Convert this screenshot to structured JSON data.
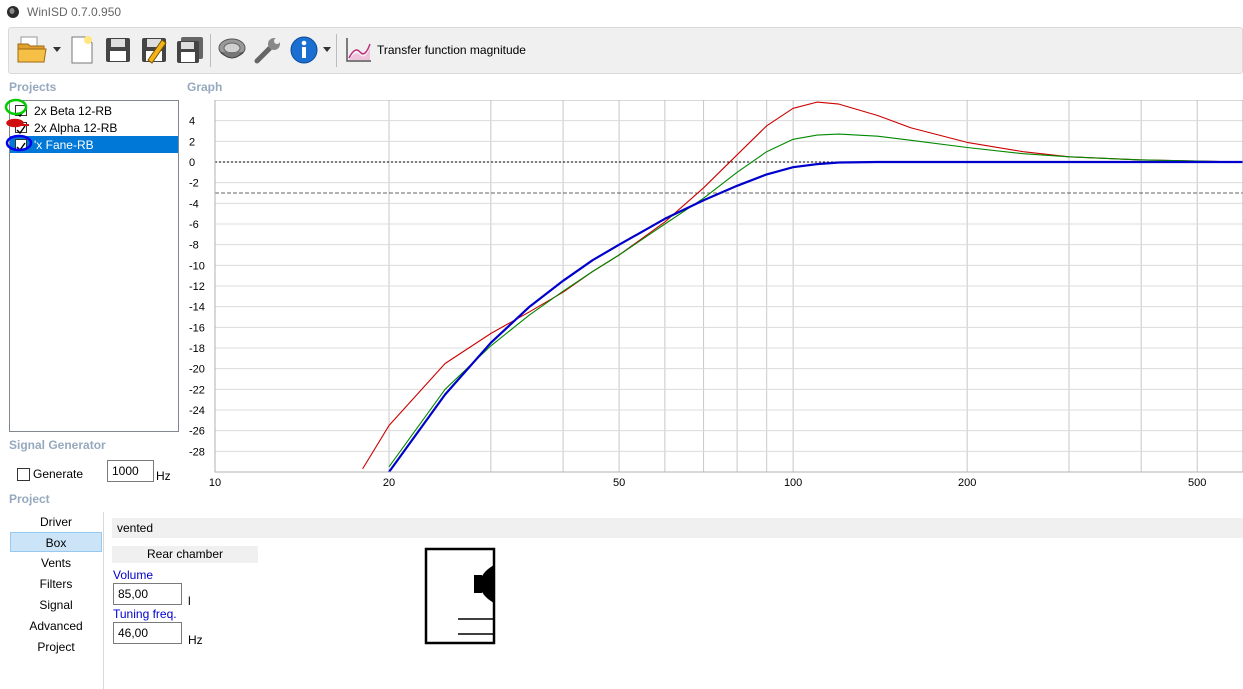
{
  "window": {
    "title": "WinISD 0.7.0.950"
  },
  "toolbar": {
    "buttons": [
      {
        "name": "open-project",
        "icon": "folder-open-icon",
        "dropdown": true
      },
      {
        "name": "new-project",
        "icon": "new-document-icon"
      },
      {
        "name": "save-project",
        "icon": "floppy-icon"
      },
      {
        "name": "save-as-project",
        "icon": "floppy-pencil-icon"
      },
      {
        "name": "save-all-projects",
        "icon": "floppy-multiple-icon"
      },
      {
        "name": "driver-editor",
        "icon": "speaker-driver-icon"
      },
      {
        "name": "tools",
        "icon": "wrench-icon"
      },
      {
        "name": "info",
        "icon": "info-icon",
        "dropdown": true
      }
    ],
    "graph_type_label": "Transfer function magnitude"
  },
  "projects": {
    "title": "Projects",
    "items": [
      {
        "label": "2x Beta 12-RB",
        "checked": true,
        "color": "#00a000",
        "selected": false
      },
      {
        "label": "2x Alpha 12-RB",
        "checked": true,
        "color": "#cc0000",
        "selected": false
      },
      {
        "label": "'x Fane-RB",
        "checked": true,
        "color": "#0000cc",
        "selected": true
      }
    ]
  },
  "signal_generator": {
    "title": "Signal Generator",
    "generate_label": "Generate",
    "generate_checked": false,
    "frequency_value": "1000",
    "frequency_unit": "Hz"
  },
  "graph": {
    "title": "Graph",
    "y_ticks": [
      "4",
      "2",
      "0",
      "-2",
      "-4",
      "-6",
      "-8",
      "-10",
      "-12",
      "-14",
      "-16",
      "-18",
      "-20",
      "-22",
      "-24",
      "-26",
      "-28"
    ],
    "x_ticks": [
      "10",
      "20",
      "50",
      "100",
      "200",
      "500"
    ]
  },
  "chart_data": {
    "type": "line",
    "title": "Transfer function magnitude",
    "xlabel": "",
    "ylabel": "",
    "x_scale": "log",
    "xlim": [
      10,
      600
    ],
    "ylim": [
      -30,
      6
    ],
    "grid": true,
    "reference_lines": [
      {
        "y": 0,
        "style": "dotted"
      },
      {
        "y": -3,
        "style": "dashed"
      }
    ],
    "series": [
      {
        "name": "2x Alpha 12-RB",
        "color": "#cc0000",
        "x": [
          18,
          20,
          25,
          30,
          35,
          40,
          45,
          50,
          60,
          70,
          80,
          90,
          100,
          110,
          120,
          140,
          160,
          200,
          250,
          300,
          400,
          500,
          600
        ],
        "y": [
          -29.7,
          -25.5,
          -19.5,
          -16.6,
          -14.5,
          -12.6,
          -10.6,
          -9.0,
          -5.8,
          -2.5,
          0.7,
          3.5,
          5.2,
          5.8,
          5.6,
          4.5,
          3.3,
          1.9,
          1.0,
          0.5,
          0.2,
          0.1,
          0.0
        ]
      },
      {
        "name": "2x Beta 12-RB",
        "color": "#008800",
        "x": [
          20,
          25,
          30,
          35,
          40,
          45,
          50,
          60,
          70,
          80,
          90,
          100,
          110,
          120,
          140,
          160,
          200,
          250,
          300,
          400,
          500,
          600
        ],
        "y": [
          -29.5,
          -22.0,
          -17.8,
          -14.8,
          -12.5,
          -10.6,
          -9.0,
          -6.0,
          -3.5,
          -1.0,
          1.0,
          2.2,
          2.6,
          2.7,
          2.5,
          2.1,
          1.4,
          0.8,
          0.5,
          0.2,
          0.1,
          0.0
        ]
      },
      {
        "name": "'x Fane-RB",
        "color": "#0000cc",
        "x": [
          20,
          25,
          30,
          35,
          40,
          45,
          50,
          60,
          70,
          80,
          90,
          100,
          110,
          120,
          140,
          160,
          200,
          300,
          400,
          500,
          600
        ],
        "y": [
          -30.0,
          -22.5,
          -17.5,
          -14.0,
          -11.5,
          -9.5,
          -8.0,
          -5.5,
          -3.7,
          -2.3,
          -1.2,
          -0.5,
          -0.2,
          -0.05,
          0.0,
          0.0,
          0.0,
          0.0,
          0.0,
          0.0,
          0.0
        ]
      }
    ]
  },
  "project_section": {
    "title": "Project",
    "nav": [
      "Driver",
      "Box",
      "Vents",
      "Filters",
      "Signal",
      "Advanced",
      "Project"
    ],
    "active_nav": "Box"
  },
  "box": {
    "type": "vented",
    "chamber_label": "Rear chamber",
    "volume_label": "Volume",
    "volume_value": "85,00",
    "volume_unit": "l",
    "tuning_label": "Tuning freq.",
    "tuning_value": "46,00",
    "tuning_unit": "Hz"
  }
}
